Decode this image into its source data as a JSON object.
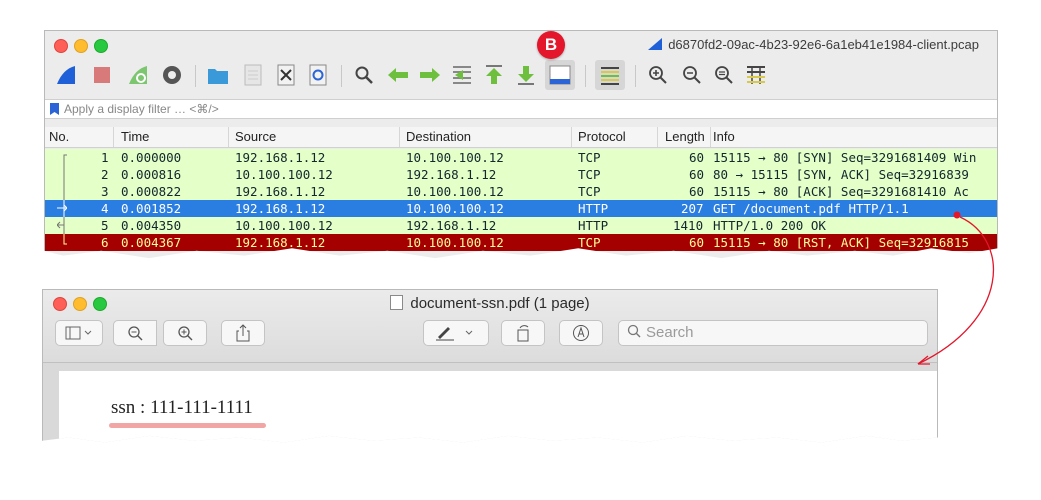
{
  "wireshark": {
    "title": "d6870fd2-09ac-4b23-92e6-6a1eb41e1984-client.pcap",
    "filter_placeholder": "Apply a display filter … <⌘/>",
    "columns": [
      "No.",
      "Time",
      "Source",
      "Destination",
      "Protocol",
      "Length",
      "Info"
    ],
    "packets": [
      {
        "no": "1",
        "time": "0.000000",
        "src": "192.168.1.12",
        "dst": "10.100.100.12",
        "proto": "TCP",
        "len": "60",
        "info": "15115 → 80 [SYN] Seq=3291681409 Win"
      },
      {
        "no": "2",
        "time": "0.000816",
        "src": "10.100.100.12",
        "dst": "192.168.1.12",
        "proto": "TCP",
        "len": "60",
        "info": "80 → 15115 [SYN, ACK] Seq=32916839"
      },
      {
        "no": "3",
        "time": "0.000822",
        "src": "192.168.1.12",
        "dst": "10.100.100.12",
        "proto": "TCP",
        "len": "60",
        "info": "15115 → 80 [ACK] Seq=3291681410 Ac"
      },
      {
        "no": "4",
        "time": "0.001852",
        "src": "192.168.1.12",
        "dst": "10.100.100.12",
        "proto": "HTTP",
        "len": "207",
        "info": "GET /document.pdf HTTP/1.1"
      },
      {
        "no": "5",
        "time": "0.004350",
        "src": "10.100.100.12",
        "dst": "192.168.1.12",
        "proto": "HTTP",
        "len": "1410",
        "info": "HTTP/1.0 200 OK"
      },
      {
        "no": "6",
        "time": "0.004367",
        "src": "192.168.1.12",
        "dst": "10.100.100.12",
        "proto": "TCP",
        "len": "60",
        "info": "15115 → 80 [RST, ACK] Seq=32916815"
      }
    ],
    "toolbar_icons": [
      "shark-fin-start-icon",
      "stop-capture-icon",
      "restart-capture-icon",
      "capture-options-icon",
      "open-file-icon",
      "save-file-icon",
      "close-file-icon",
      "reload-file-icon",
      "find-packet-icon",
      "go-back-icon",
      "go-forward-icon",
      "go-to-packet-icon",
      "go-first-packet-icon",
      "go-last-packet-icon",
      "auto-scroll-icon",
      "colorize-icon",
      "zoom-in-icon",
      "zoom-out-icon",
      "zoom-normal-icon",
      "resize-columns-icon"
    ],
    "colors": {
      "tcp_row": "#e4ffc7",
      "selected_row": "#2a7de1",
      "rst_row": "#a40000",
      "rst_text": "#fffc9c"
    }
  },
  "badge": {
    "label": "B",
    "color": "#e3162b"
  },
  "preview": {
    "title": "document-ssn.pdf (1 page)",
    "search_placeholder": "Search",
    "document_text": "ssn : 111-111-1111"
  }
}
